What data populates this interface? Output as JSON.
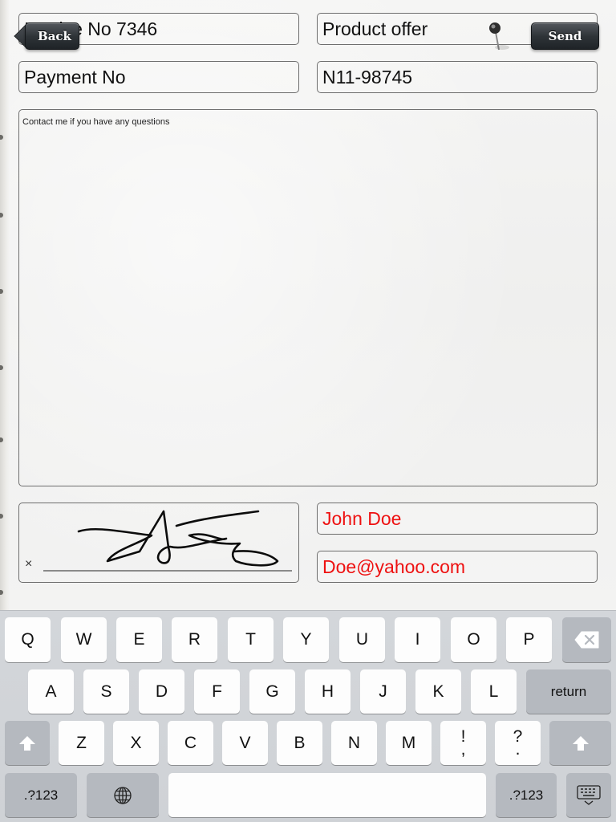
{
  "nav": {
    "back_label": "Back",
    "send_label": "Send"
  },
  "form": {
    "invoice_no": "Invoice No 7346",
    "subject": "Product offer",
    "payment_label": "Payment No",
    "payment_value": "N11-98745",
    "notes": "Contact me if you have any questions",
    "signature_mark": "×",
    "name": "John Doe",
    "email": "Doe@yahoo.com",
    "colors": {
      "contact_text": "#ee1111",
      "paper": "#f3f3f2",
      "button_dark": "#2f3438"
    }
  },
  "keyboard": {
    "row1": [
      "Q",
      "W",
      "E",
      "R",
      "T",
      "Y",
      "U",
      "I",
      "O",
      "P"
    ],
    "backspace_icon": "backspace-icon",
    "row2": [
      "A",
      "S",
      "D",
      "F",
      "G",
      "H",
      "J",
      "K",
      "L"
    ],
    "return_label": "return",
    "shift_icon": "shift-icon",
    "row3": [
      "Z",
      "X",
      "C",
      "V",
      "B",
      "N",
      "M"
    ],
    "exclaim_top": "!",
    "exclaim_bottom": ",",
    "question_top": "?",
    "question_bottom": ".",
    "numbers_label": ".?123",
    "globe_icon": "globe-icon",
    "hide_keyboard_icon": "keyboard-hide-icon"
  }
}
